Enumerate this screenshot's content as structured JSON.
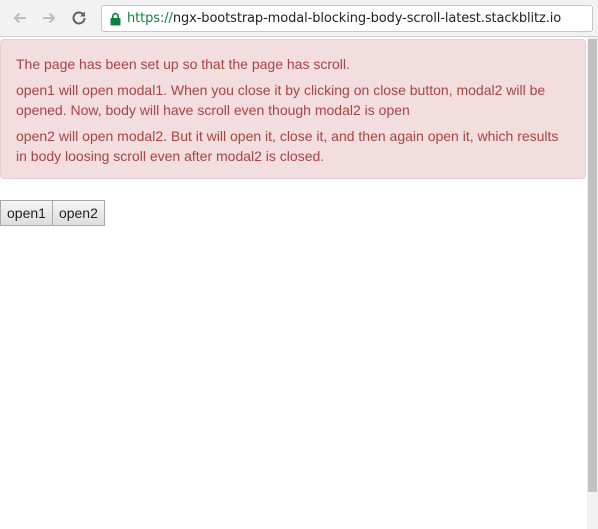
{
  "browser": {
    "url_scheme": "https://",
    "url_host": "ngx-bootstrap-modal-blocking-body-scroll-latest.stackblitz.io",
    "icons": [
      "back-arrow-icon",
      "forward-arrow-icon",
      "reload-icon",
      "lock-icon"
    ],
    "secure_color": "#0b8043"
  },
  "alert": {
    "line1": "The page has been set up so that the page has scroll.",
    "line2": "open1 will open modal1. When you close it by clicking on close button, modal2 will be opened. Now, body will have scroll even though modal2 is open",
    "line3": "open2 will open modal2. But it will open it, close it, and then again open it, which results in body loosing scroll even after modal2 is closed.",
    "bg_color": "#f2dede",
    "text_color": "#a94442"
  },
  "buttons": {
    "open1": "open1",
    "open2": "open2"
  }
}
